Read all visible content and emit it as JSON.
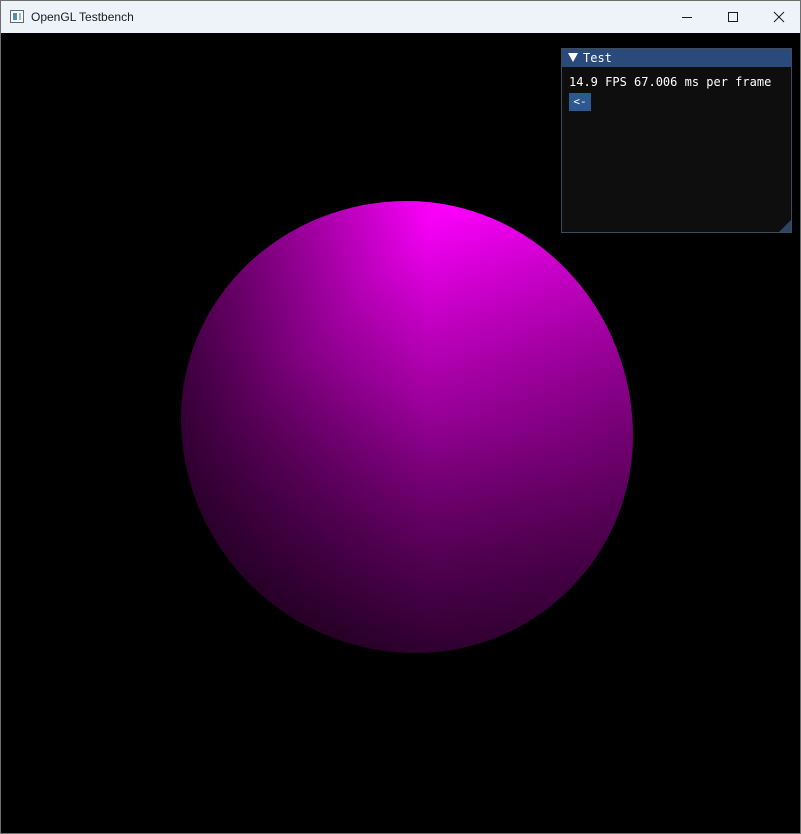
{
  "window": {
    "title": "OpenGL Testbench",
    "icons": {
      "app": "app-window-icon",
      "minimize": "minimize-icon",
      "maximize": "maximize-icon",
      "close": "close-icon"
    }
  },
  "scene": {
    "object": "sphere",
    "color": "#ff00ff",
    "background": "#000000"
  },
  "imgui": {
    "title": "Test",
    "collapse_icon": "triangle-down-icon",
    "fps_text": "14.9 FPS 67.006 ms per frame",
    "back_button_label": "<-",
    "title_color": "#294a7a",
    "button_color": "#2d5a8e"
  }
}
